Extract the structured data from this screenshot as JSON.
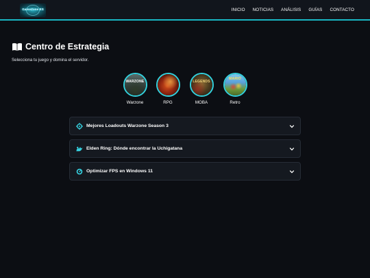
{
  "header": {
    "logo_text": "GameZone ES",
    "nav": [
      "INICIO",
      "NOTICIAS",
      "ANÁLISIS",
      "GUÍAS",
      "CONTACTO"
    ]
  },
  "main": {
    "title": "Centro de Estrategia",
    "subtitle": "Selecciona tu juego y domina el servidor."
  },
  "games": [
    {
      "label": "Warzone",
      "art_text": "WARZONE"
    },
    {
      "label": "RPG",
      "art_text": ""
    },
    {
      "label": "MOBA",
      "art_text": "LEGENDS"
    },
    {
      "label": "Retro",
      "art_text": "MARIO"
    }
  ],
  "guides": [
    {
      "title": "Mejores Loadouts Warzone Season 3",
      "icon": "crosshair-icon"
    },
    {
      "title": "Elden Ring: Dónde encontrar la Uchigatana",
      "icon": "dragon-icon"
    },
    {
      "title": "Optimizar FPS en Windows 11",
      "icon": "speedometer-icon"
    }
  ],
  "colors": {
    "accent": "#19b7c4",
    "background": "#0c0e13",
    "navbar": "#11151c",
    "card": "#151920"
  }
}
